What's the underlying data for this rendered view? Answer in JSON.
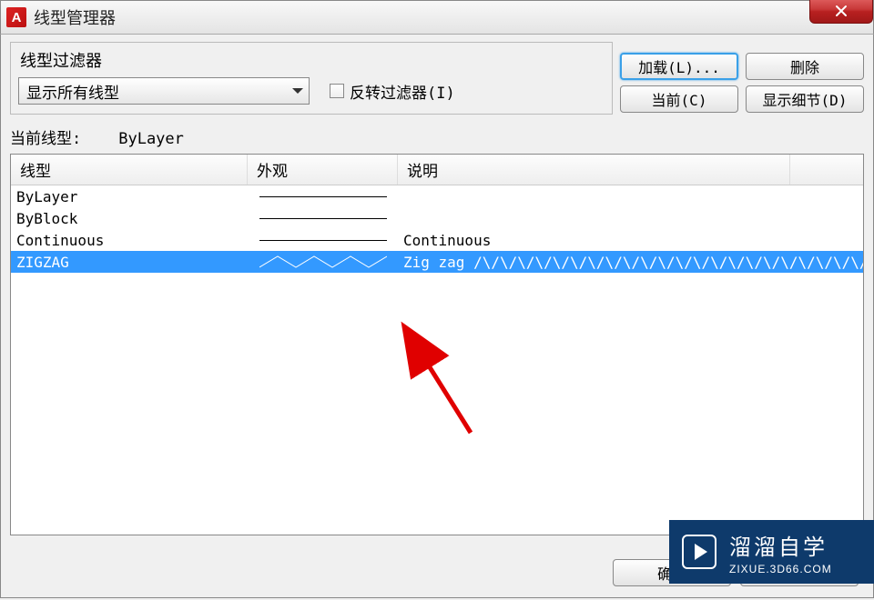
{
  "titlebar": {
    "app_icon_letter": "A",
    "title": "线型管理器",
    "close_label": "X"
  },
  "filter": {
    "legend": "线型过滤器",
    "dropdown_value": "显示所有线型",
    "invert_label": "反转过滤器(I)"
  },
  "buttons": {
    "load": "加载(L)...",
    "delete": "删除",
    "current": "当前(C)",
    "details": "显示细节(D)"
  },
  "current_linetype": {
    "label": "当前线型:",
    "value": "ByLayer"
  },
  "columns": {
    "name": "线型",
    "appearance": "外观",
    "description": "说明"
  },
  "rows": [
    {
      "name": "ByLayer",
      "appearance": "solid",
      "description": ""
    },
    {
      "name": "ByBlock",
      "appearance": "solid",
      "description": ""
    },
    {
      "name": "Continuous",
      "appearance": "solid",
      "description": "Continuous"
    },
    {
      "name": "ZIGZAG",
      "appearance": "zigzag",
      "description": "Zig zag /\\/\\/\\/\\/\\/\\/\\/\\/\\/\\/\\/\\/\\/\\/\\/\\/\\/\\/\\/\\/\\/\\/\\/\\/\\",
      "selected": true
    }
  ],
  "bottom": {
    "ok": "确定",
    "cancel": ""
  },
  "watermark": {
    "main": "溜溜自学",
    "sub": "ZIXUE.3D66.COM"
  }
}
